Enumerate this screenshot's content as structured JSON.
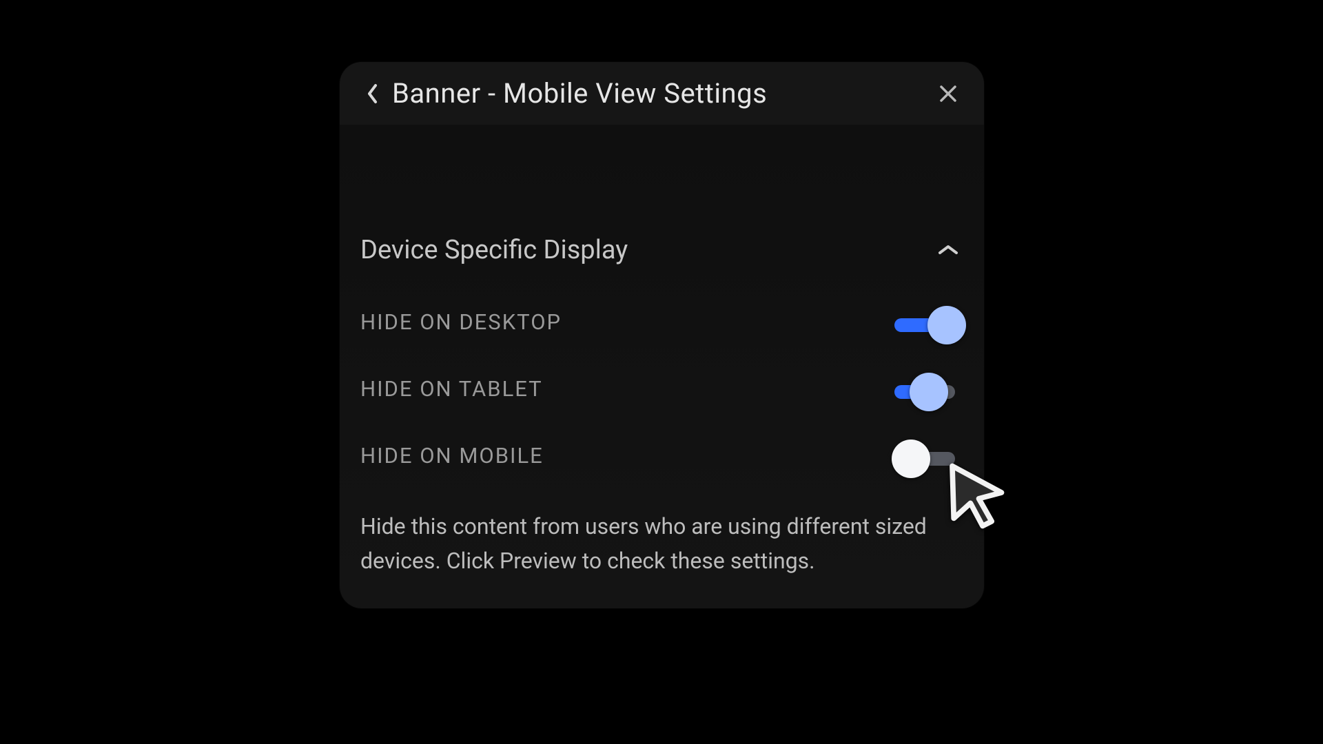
{
  "header": {
    "title": "Banner - Mobile View Settings"
  },
  "section": {
    "title": "Device Specific Display"
  },
  "toggles": {
    "desktop": {
      "label": "HIDE ON DESKTOP",
      "state": "on"
    },
    "tablet": {
      "label": "HIDE ON TABLET",
      "state": "mid"
    },
    "mobile": {
      "label": "HIDE ON MOBILE",
      "state": "off"
    }
  },
  "help_text": "Hide this content from users who are using different sized devices. Click Preview to check these settings.",
  "icons": {
    "back": "chevron-left-icon",
    "close": "close-icon",
    "collapse": "chevron-up-icon",
    "cursor": "cursor-icon"
  },
  "colors": {
    "accent": "#2f6bff",
    "panel": "#141414"
  }
}
